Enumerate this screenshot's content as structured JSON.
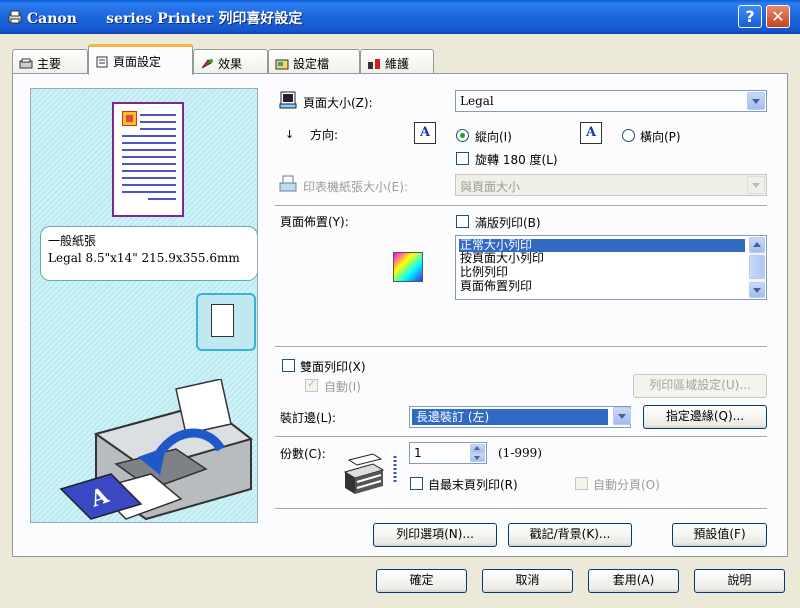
{
  "window": {
    "title": "Canon      series Printer 列印喜好設定",
    "help_label": "?",
    "close_label": "✕"
  },
  "tabs": [
    {
      "label": "主要",
      "icon": "main-tab-icon"
    },
    {
      "label": "頁面設定",
      "icon": "page-setup-icon",
      "active": true
    },
    {
      "label": "效果",
      "icon": "effects-icon"
    },
    {
      "label": "設定檔",
      "icon": "profiles-icon"
    },
    {
      "label": "維護",
      "icon": "maintenance-icon"
    }
  ],
  "preview": {
    "paper_type": "一般紙張",
    "paper_size_info": "Legal 8.5\"x14\" 215.9x355.6mm"
  },
  "page_size": {
    "label": "頁面大小(Z):",
    "value": "Legal"
  },
  "orientation": {
    "label": "方向:",
    "portrait_label": "縱向(I)",
    "landscape_label": "橫向(P)",
    "rotate_label": "旋轉 180 度(L)",
    "icon_letter": "A",
    "selected": "portrait"
  },
  "printer_paper_size": {
    "label": "印表機紙張大小(E):",
    "value": "與頁面大小"
  },
  "page_layout": {
    "label": "頁面佈置(Y):",
    "borderless_label": "滿版列印(B)",
    "options": [
      "正常大小列印",
      "按頁面大小列印",
      "比例列印",
      "頁面佈置列印"
    ],
    "selected_index": 0
  },
  "duplex": {
    "label": "雙面列印(X)",
    "auto_label": "自動(I)",
    "print_area_button": "列印區域設定(U)..."
  },
  "binding": {
    "label": "裝訂邊(L):",
    "value": "長邊裝訂 (左)",
    "margin_button": "指定邊緣(Q)..."
  },
  "copies": {
    "label": "份數(C):",
    "value": "1",
    "range": "(1-999)",
    "reverse_label": "自最末頁列印(R)",
    "collate_label": "自動分頁(O)"
  },
  "actions": {
    "print_options": "列印選項(N)...",
    "stamp_background": "戳記/背景(K)...",
    "defaults": "預設值(F)"
  },
  "footer": {
    "ok": "確定",
    "cancel": "取消",
    "apply": "套用(A)",
    "help": "說明"
  },
  "colors": {
    "titlebar": "#1d66dc",
    "selection": "#316ac5",
    "preview_bg": "#bdebf2",
    "tab_highlight": "#f5b445"
  }
}
